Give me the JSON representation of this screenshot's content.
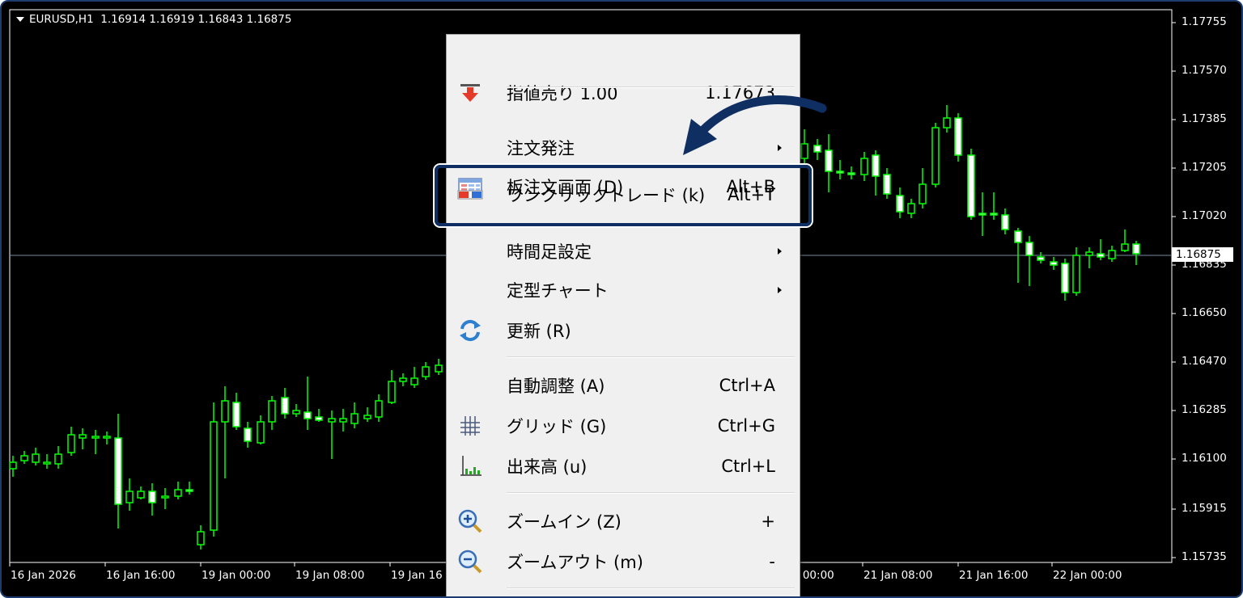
{
  "chart": {
    "symbol_info": "EURUSD,H1  1.16914 1.16919 1.16843 1.16875",
    "current_price": "1.16875",
    "colors": {
      "background": "#000000",
      "candles": "#00ff00",
      "bull_body": "#000000",
      "bear_body": "#ffffff",
      "price_line": "#7a8aa0"
    },
    "price_axis": [
      "1.17755",
      "1.17570",
      "1.17385",
      "1.17205",
      "1.17020",
      "1.16835",
      "1.16650",
      "1.16470",
      "1.16285",
      "1.16100",
      "1.15915",
      "1.15735"
    ],
    "time_axis": [
      "16 Jan 2026",
      "16 Jan 16:00",
      "19 Jan 00:00",
      "19 Jan 08:00",
      "19 Jan 16",
      "n 00:00",
      "21 Jan 08:00",
      "21 Jan 16:00",
      "22 Jan 00:00"
    ]
  },
  "context_menu": {
    "items": [
      {
        "id": "sell-limit",
        "icon": "arrow-down-red-icon",
        "label": "指値売り 1.00",
        "shortcut": "1.17673"
      },
      {
        "id": "new-order",
        "icon": "",
        "label": "注文発注",
        "submenu": true
      },
      {
        "id": "depth-of-market",
        "icon": "order-book-icon",
        "label": "板注文画面 (D)",
        "shortcut": "Alt+B"
      },
      {
        "id": "one-click-trading",
        "icon": "one-click-trade-icon",
        "label": "ワンクリックトレード (k)",
        "shortcut": "Alt+T"
      },
      {
        "id": "timeframes",
        "icon": "",
        "label": "時間足設定",
        "submenu": true
      },
      {
        "id": "templates",
        "icon": "",
        "label": "定型チャート",
        "submenu": true
      },
      {
        "id": "refresh",
        "icon": "refresh-icon",
        "label": "更新 (R)"
      },
      {
        "id": "auto-scroll",
        "icon": "",
        "label": "自動調整 (A)",
        "shortcut": "Ctrl+A"
      },
      {
        "id": "grid",
        "icon": "grid-icon",
        "label": "グリッド (G)",
        "shortcut": "Ctrl+G"
      },
      {
        "id": "volumes",
        "icon": "volumes-icon",
        "label": "出来高 (u)",
        "shortcut": "Ctrl+L"
      },
      {
        "id": "zoom-in",
        "icon": "zoom-in-icon",
        "label": "ズームイン (Z)",
        "shortcut": "+"
      },
      {
        "id": "zoom-out",
        "icon": "zoom-out-icon",
        "label": "ズームアウト (m)",
        "shortcut": "-"
      }
    ]
  },
  "annotation": {
    "highlight_color": "#0f2f63",
    "highlight_target": "one-click-trading"
  }
}
